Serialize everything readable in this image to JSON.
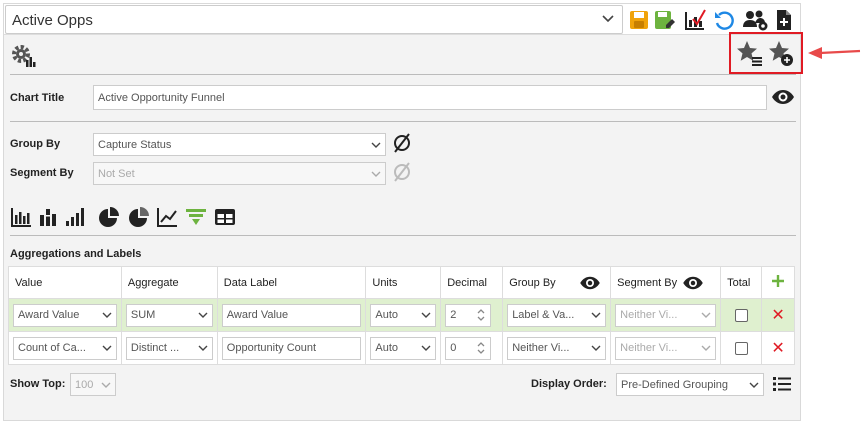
{
  "report": {
    "name": "Active Opps"
  },
  "chart": {
    "title_label": "Chart Title",
    "title_value": "Active Opportunity Funnel",
    "group_by_label": "Group By",
    "group_by_value": "Capture Status",
    "segment_by_label": "Segment By",
    "segment_by_value": "Not Set"
  },
  "aggregations": {
    "section_label": "Aggregations and Labels",
    "columns": [
      "Value",
      "Aggregate",
      "Data Label",
      "Units",
      "Decimal",
      "Group By",
      "Segment By",
      "Total"
    ],
    "rows": [
      {
        "value": "Award Value",
        "aggregate": "SUM",
        "data_label": "Award Value",
        "units": "Auto",
        "decimal": "2",
        "group_by": "Label & Va...",
        "segment_by": "Neither Vi...",
        "total": false
      },
      {
        "value": "Count of Ca...",
        "aggregate": "Distinct ...",
        "data_label": "Opportunity Count",
        "units": "Auto",
        "decimal": "0",
        "group_by": "Neither Vi...",
        "segment_by": "Neither Vi...",
        "total": false
      }
    ]
  },
  "footer": {
    "show_top_label": "Show Top:",
    "show_top_value": "100",
    "display_order_label": "Display Order:",
    "display_order_value": "Pre-Defined Grouping"
  },
  "colors": {
    "accent_green": "#6db33f",
    "highlight_row": "#dff0cf",
    "delete_red": "#e01b24",
    "save_orange": "#f0a30a",
    "undo_blue": "#1e88e5"
  }
}
